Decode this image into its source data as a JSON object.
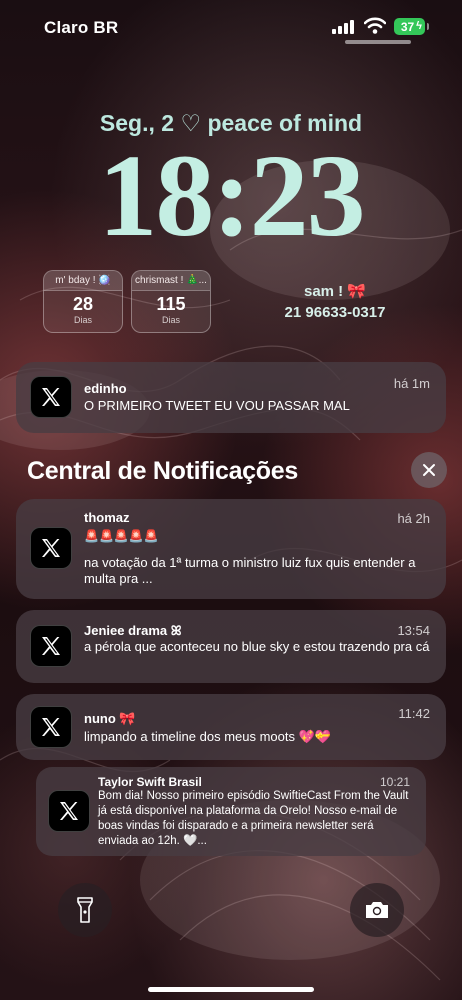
{
  "status": {
    "carrier": "Claro BR",
    "battery": "37"
  },
  "lock": {
    "date": "Seg., 2 ♡ peace of mind",
    "time": "18:23",
    "widgets": [
      {
        "title": "m' bday ! 🪩",
        "number": "28",
        "unit": "Dias"
      },
      {
        "title": "chrismast ! 🎄...",
        "number": "115",
        "unit": "Dias"
      }
    ],
    "contact": {
      "name": "sam ! 🎀",
      "phone": "21 96633-0317"
    }
  },
  "top_notification": {
    "title": "edinho",
    "time": "há 1m",
    "body": "O PRIMEIRO TWEET EU VOU PASSAR MAL"
  },
  "center": {
    "title": "Central de Notificações"
  },
  "notifications": [
    {
      "title": "thomaz",
      "emojis": "🚨🚨🚨🚨🚨",
      "time": "há 2h",
      "body": "na votação da 1ª turma o ministro luiz fux quis entender a multa pra ..."
    },
    {
      "title": "Jeniee drama ꕤ",
      "time": "13:54",
      "body": "a pérola que aconteceu no blue sky e estou trazendo pra cá"
    },
    {
      "title": "nuno 🎀",
      "time": "11:42",
      "body": "limpando a timeline dos meus moots 💖💝"
    },
    {
      "title": "Taylor Swift Brasil",
      "time": "10:21",
      "body": "Bom dia! Nosso primeiro episódio SwiftieCast From the Vault já está disponível na plataforma da Orelo! Nosso e-mail de boas vindas foi disparado e a primeira newsletter será enviada ao 12h. 🤍..."
    }
  ],
  "icons": {
    "app": "x-logo-icon",
    "flashlight": "flashlight-icon",
    "camera": "camera-icon",
    "clear": "close-icon"
  },
  "colors": {
    "clock": "#c4eee3",
    "battery": "#34c759"
  }
}
